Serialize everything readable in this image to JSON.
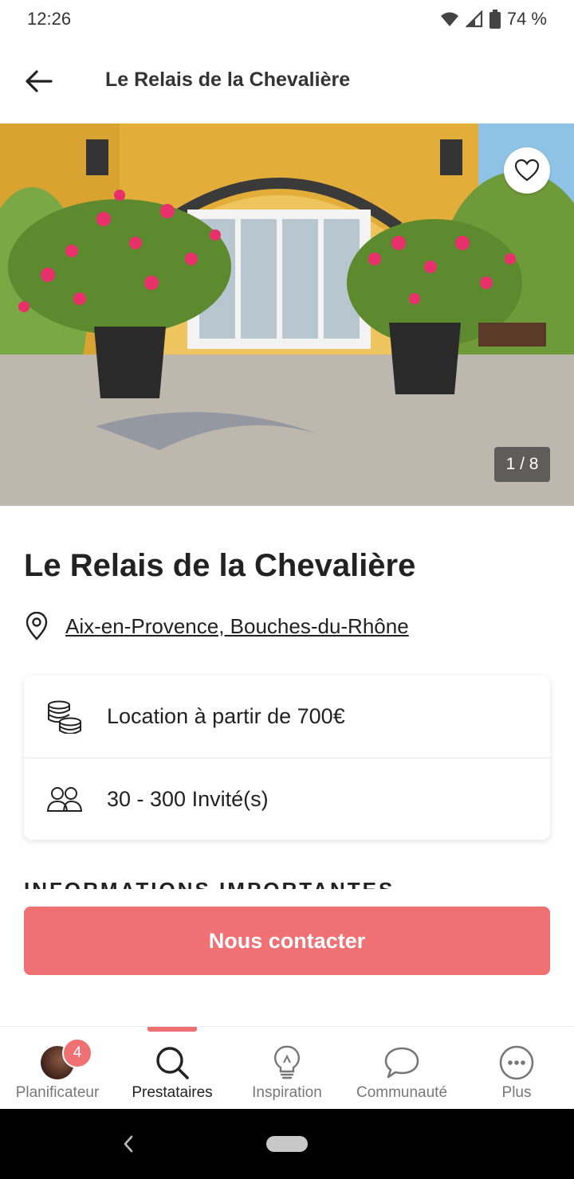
{
  "status": {
    "time": "12:26",
    "battery": "74 %"
  },
  "appbar": {
    "title": "Le Relais de la Chevalière"
  },
  "gallery": {
    "counter": "1 / 8"
  },
  "venue": {
    "name": "Le Relais de la Chevalière",
    "location": "Aix-en-Provence, Bouches-du-Rhône",
    "price": "Location à partir de 700€",
    "guests": "30 - 300 Invité(s)"
  },
  "section": {
    "partial_heading": "INFORMATIONS IMPORTANTES"
  },
  "cta": {
    "label": "Nous contacter"
  },
  "tabs": [
    {
      "label": "Planificateur",
      "badge": "4",
      "icon": "avatar"
    },
    {
      "label": "Prestataires",
      "icon": "search-icon",
      "active": true
    },
    {
      "label": "Inspiration",
      "icon": "lightbulb-icon"
    },
    {
      "label": "Communauté",
      "icon": "chat-bubble-icon"
    },
    {
      "label": "Plus",
      "icon": "more-icon"
    }
  ],
  "colors": {
    "accent": "#f07174"
  }
}
